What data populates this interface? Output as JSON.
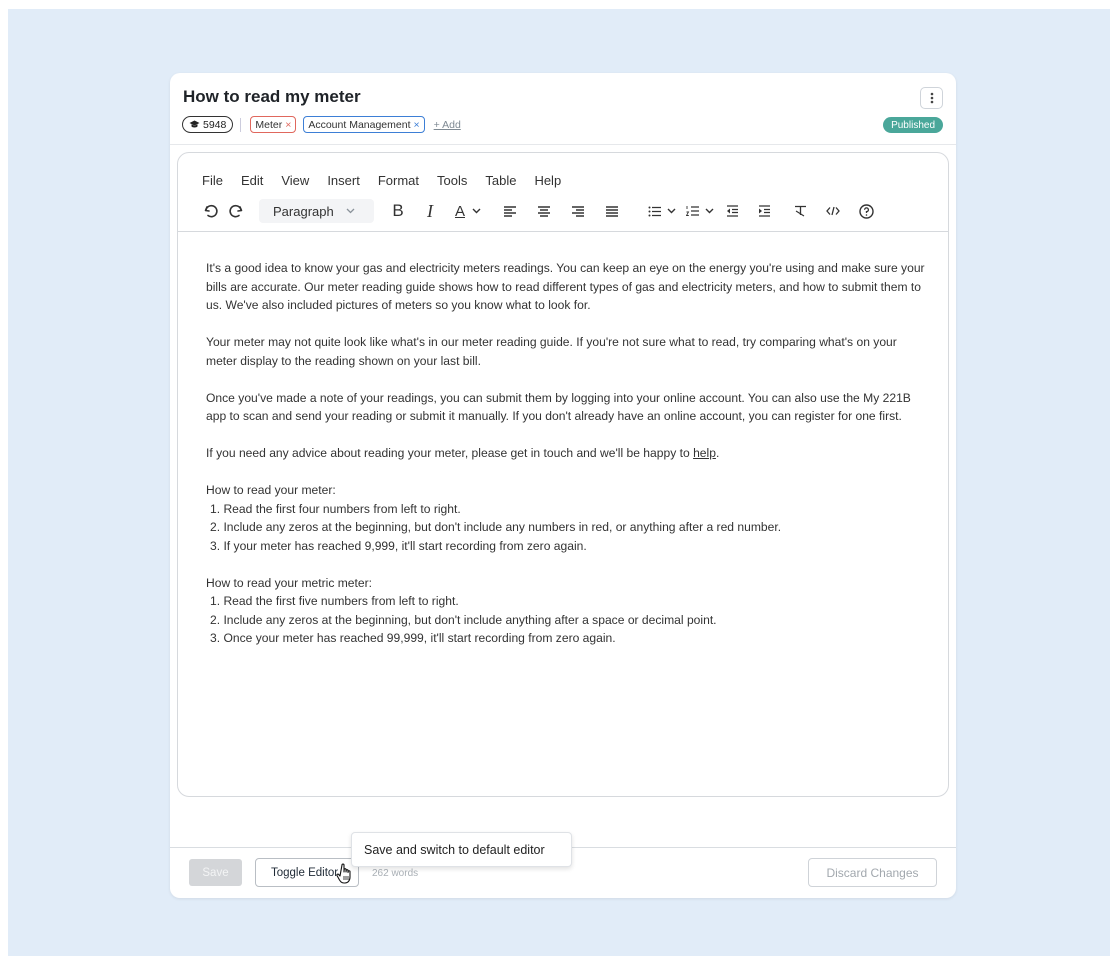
{
  "article": {
    "title": "How to read my meter",
    "id_badge": "5948",
    "tags": [
      {
        "label": "Meter",
        "remove": "×",
        "color": "#e0675d"
      },
      {
        "label": "Account Management",
        "remove": "×",
        "color": "#3d7fd6"
      }
    ],
    "add_tag_label": "+ Add",
    "status": "Published",
    "status_color": "#4aa79a"
  },
  "editor": {
    "menu": [
      "File",
      "Edit",
      "View",
      "Insert",
      "Format",
      "Tools",
      "Table",
      "Help"
    ],
    "block_format": "Paragraph",
    "toolbar_icons": [
      "undo-icon",
      "redo-icon",
      "bold-icon",
      "italic-icon",
      "text-color-icon",
      "align-left-icon",
      "align-center-icon",
      "align-right-icon",
      "align-justify-icon",
      "bullet-list-icon",
      "numbered-list-icon",
      "outdent-icon",
      "indent-icon",
      "clear-format-icon",
      "source-code-icon",
      "help-icon"
    ],
    "toolbar_glyphs": {
      "undo": "↺",
      "redo": "↻",
      "bold": "B",
      "italic": "I",
      "text_color": "A",
      "chev": "⌄",
      "help": "?"
    }
  },
  "body": {
    "p1": "It's a good idea to know your gas and electricity meters readings. You can keep an eye on the energy you're using and make sure your bills are accurate. Our meter reading guide shows how to read different types of gas and electricity meters, and how to submit them to us. We've also included pictures of meters so you know what to look for.",
    "p2": "Your meter may not quite look like what's in our meter reading guide. If you're not sure what to read, try comparing what's on your meter display to the reading shown on your last bill.",
    "p3": "Once you've made a note of your readings, you can submit them by logging into your online account. You can also use the My 221B app to scan and send your reading or submit it manually. If you don't already have an online account, you can register for one first.",
    "p4_before": "If you need any advice about reading your meter, please get in touch and we'll be happy to ",
    "p4_link": "help",
    "p4_after": ".",
    "list1_heading": "How to read your meter:",
    "list1": [
      "1. Read the first four numbers from left to right.",
      "2. Include any zeros at the beginning, but don't include any numbers in red, or anything after a red number.",
      "3. If your meter has reached 9,999, it'll start recording from zero again."
    ],
    "list2_heading": "How to read your metric meter:",
    "list2": [
      "1. Read the first five numbers from left to right.",
      "2. Include any zeros at the beginning, but don't include anything after a space or decimal point.",
      "3. Once your meter has reached 99,999, it'll start recording from zero again."
    ]
  },
  "footer": {
    "save_label": "Save",
    "toggle_label": "Toggle Editor",
    "word_count": "262 words",
    "discard_label": "Discard Changes",
    "tooltip": "Save and switch to default editor"
  }
}
